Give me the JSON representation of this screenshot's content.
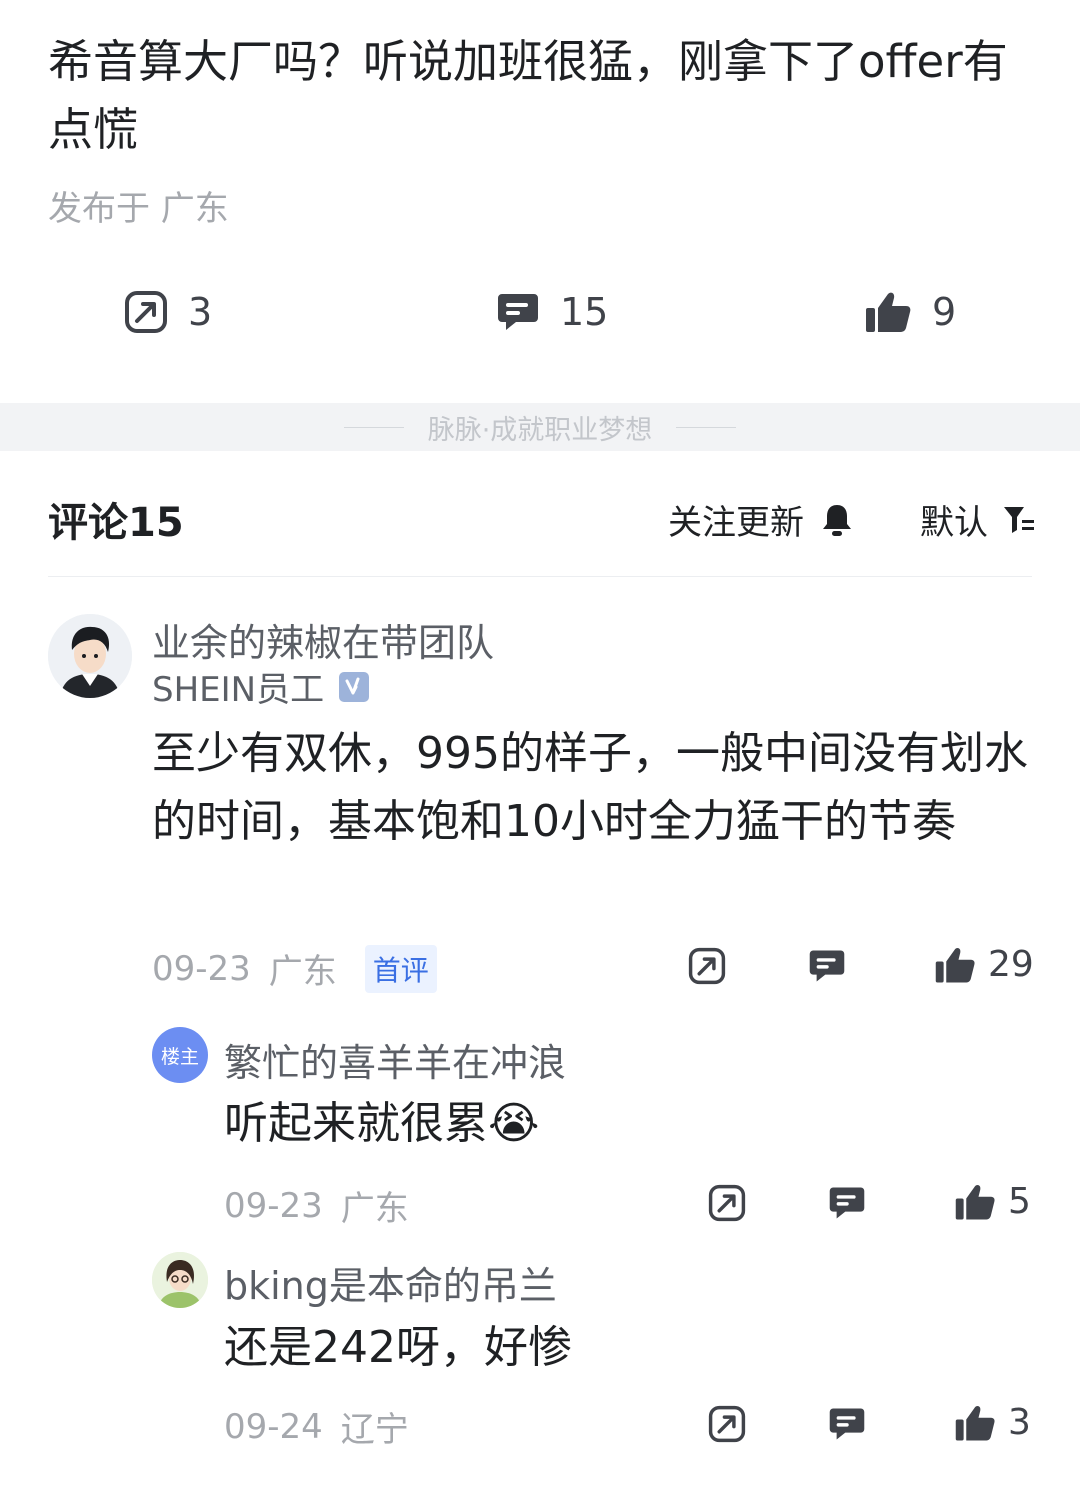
{
  "post": {
    "title": "希音算大厂吗？听说加班很猛，刚拿下了offer有点慌",
    "location": "发布于 广东",
    "stats": {
      "shares": "3",
      "comments": "15",
      "likes": "9"
    }
  },
  "slogan": "脉脉·成就职业梦想",
  "comments_header": {
    "title": "评论15",
    "follow_label": "关注更新",
    "sort_label": "默认"
  },
  "comments": [
    {
      "user": "业余的辣椒在带团队",
      "company": "SHEIN员工",
      "text": "至少有双休，995的样子，一般中间没有划水的时间，基本饱和10小时全力猛干的节奏",
      "date": "09-23",
      "location": "广东",
      "badge": "首评",
      "likes": "29"
    }
  ],
  "replies": [
    {
      "owner_badge": "楼主",
      "user": "繁忙的喜羊羊在冲浪",
      "text": "听起来就很累😭",
      "date": "09-23",
      "location": "广东",
      "likes": "5"
    },
    {
      "user": "bking是本命的吊兰",
      "text": "还是242呀，好惨",
      "date": "09-24",
      "location": "辽宁",
      "likes": "3"
    }
  ],
  "colors": {
    "accent": "#3a6fe3",
    "muted": "#a5a8ad",
    "band": "#f2f3f5",
    "icon": "#40434a"
  }
}
